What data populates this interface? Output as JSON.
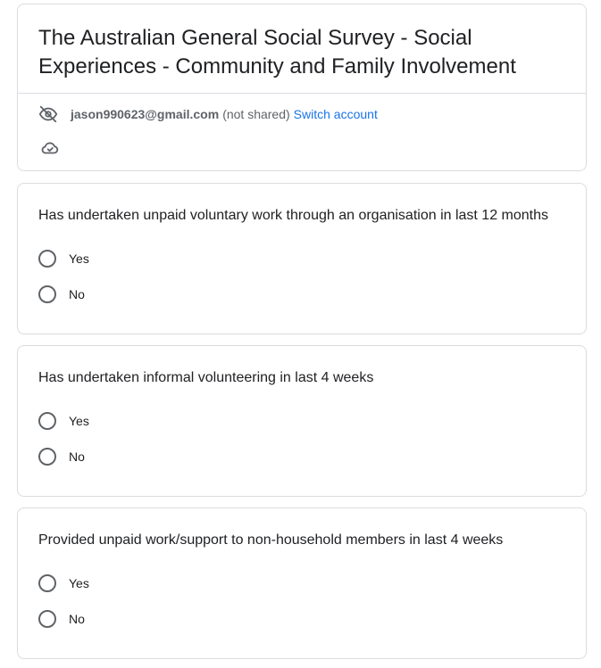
{
  "form": {
    "title": "The Australian General Social Survey - Social Experiences - Community and Family Involvement",
    "account": {
      "email": "jason990623@gmail.com",
      "not_shared": "(not shared)",
      "switch_label": "Switch account",
      "visibility_icon": "eye-off-icon",
      "saved_icon": "cloud-check-icon"
    }
  },
  "questions": [
    {
      "text": "Has undertaken unpaid voluntary work through an organisation in last 12 months",
      "options": [
        "Yes",
        "No"
      ]
    },
    {
      "text": "Has undertaken informal volunteering in last 4 weeks",
      "options": [
        "Yes",
        "No"
      ]
    },
    {
      "text": "Provided unpaid work/support to non-household members in last 4 weeks",
      "options": [
        "Yes",
        "No"
      ]
    }
  ],
  "colors": {
    "accent": "#1a73e8",
    "border": "#dadce0",
    "text": "#202124",
    "muted": "#5f6368"
  }
}
